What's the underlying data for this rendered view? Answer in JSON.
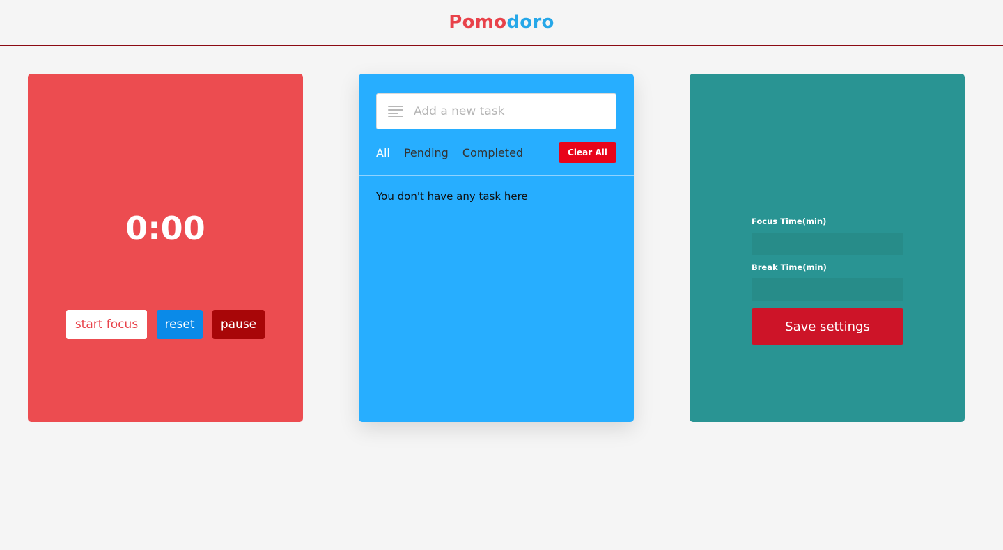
{
  "header": {
    "logo_part1": "Pomo",
    "logo_part2": "doro"
  },
  "timer": {
    "display": "0:00",
    "start_label": "start focus",
    "reset_label": "reset",
    "pause_label": "pause"
  },
  "tasks": {
    "input_placeholder": "Add a new task",
    "input_value": "",
    "filters": [
      "All",
      "Pending",
      "Completed"
    ],
    "active_filter": "All",
    "clear_label": "Clear All",
    "empty_message": "You don't have any task here"
  },
  "settings": {
    "focus_label": "Focus Time(min)",
    "focus_value": "",
    "break_label": "Break Time(min)",
    "break_value": "",
    "save_label": "Save settings"
  },
  "colors": {
    "logo_red": "#e8424a",
    "logo_blue": "#26a7e8",
    "timer_card": "#ec4c50",
    "tasks_card": "#27aeff",
    "settings_card": "#299493",
    "reset_button": "#0a8ae8",
    "pause_button": "#a80608",
    "clear_button": "#e8041a",
    "save_button": "#cd1428"
  },
  "icons": {
    "task_input_icon": "lines-icon"
  }
}
